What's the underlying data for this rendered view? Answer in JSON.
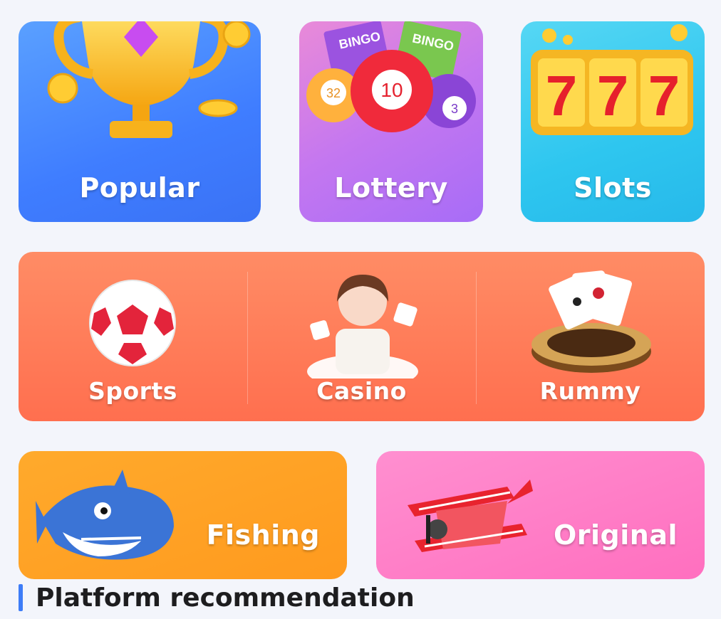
{
  "categories": {
    "popular": {
      "label": "Popular",
      "icon": "trophy-icon"
    },
    "lottery": {
      "label": "Lottery",
      "icon": "lottery-balls-icon",
      "ticket_text": "BINGO",
      "ball_numbers": [
        "32",
        "10",
        "3"
      ]
    },
    "slots": {
      "label": "Slots",
      "icon": "slot-machine-icon",
      "reel_symbols": [
        "7",
        "7",
        "7"
      ]
    },
    "sports": {
      "label": "Sports",
      "icon": "soccer-ball-icon"
    },
    "casino": {
      "label": "Casino",
      "icon": "casino-dealer-icon"
    },
    "rummy": {
      "label": "Rummy",
      "icon": "playing-cards-icon"
    },
    "fishing": {
      "label": "Fishing",
      "icon": "shark-icon"
    },
    "original": {
      "label": "Original",
      "icon": "biplane-icon"
    }
  },
  "section": {
    "title": "Platform recommendation"
  },
  "colors": {
    "popular": "#3f7dff",
    "lottery": "#c477f0",
    "slots": "#2ec6ef",
    "band": "#ff7656",
    "fishing": "#ffa224",
    "original": "#ff7fc7",
    "accent_bar": "#3d7cf7"
  }
}
